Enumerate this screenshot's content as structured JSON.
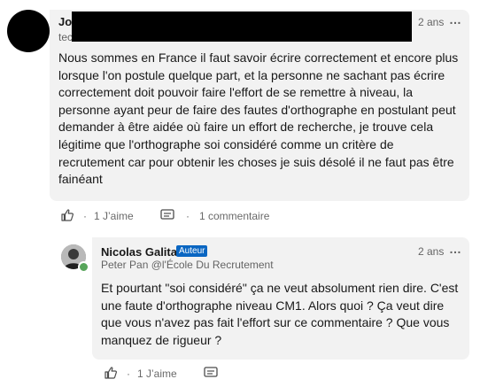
{
  "comment1": {
    "author_name": "Jo",
    "author_subtitle": "tec",
    "time": "2 ans",
    "more_label": "…",
    "text": "Nous sommes en France il faut savoir écrire correctement et encore plus lorsque l'on postule quelque part, et la personne ne sachant pas écrire correctement doit pouvoir faire l'effort de se remettre à niveau, la personne ayant peur de faire des fautes d'orthographe en postulant peut demander à être aidée où faire un effort de recherche, je trouve cela légitime que l'orthographe soi considéré comme un critère de recrutement car pour obtenir les choses je suis désolé il ne faut pas être fainéant",
    "like_count": "1 J’aime",
    "reply_count": "1 commentaire",
    "separator": "·"
  },
  "comment2": {
    "author_name": "Nicolas Galita",
    "badge": "Auteur",
    "author_subtitle": "Peter Pan @l'École Du Recrutement",
    "time": "2 ans",
    "more_label": "…",
    "text": "Et pourtant \"soi considéré\" ça ne veut absolument rien dire. C'est une faute d'orthographe niveau CM1. Alors quoi ? Ça veut dire que vous n'avez pas fait l'effort sur ce commentaire ? Que vous manquez de rigueur ?",
    "like_count": "1 J’aime",
    "separator": "·"
  },
  "colors": {
    "bubble": "#f2f2f2",
    "badge": "#0a66c2",
    "online": "#57a55a"
  }
}
